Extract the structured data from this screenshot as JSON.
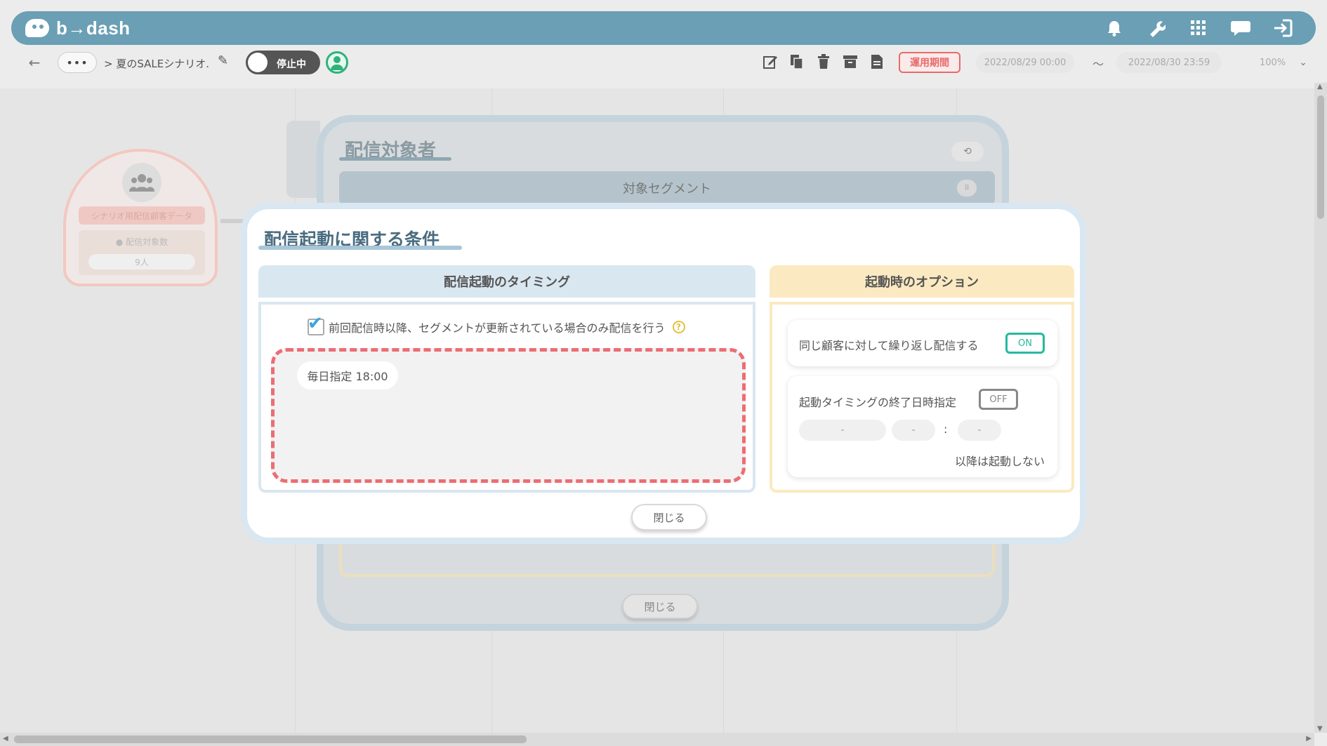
{
  "header": {
    "logo_text": "b→dash",
    "icons": [
      "bell-icon",
      "wrench-icon",
      "apps-grid-icon",
      "chat-icon",
      "logout-icon"
    ]
  },
  "toolbar": {
    "dots_label": "•••",
    "breadcrumb": "> 夏のSALEシナリオ.",
    "status_toggle_label": "停止中",
    "period_label": "運用期間",
    "start_date": "2022/08/29 00:00",
    "tilde": "〜",
    "end_date": "2022/08/30 23:59",
    "zoom": "100%",
    "tool_icons": [
      "edit-icon",
      "copy-icon",
      "trash-icon",
      "archive-icon",
      "document-icon"
    ]
  },
  "canvas_node": {
    "title": "シナリオ用配信顧客データ",
    "sub_label": "配信対象数",
    "value": "9人"
  },
  "background_modal": {
    "title": "配信対象者",
    "section_label": "対象セグメント",
    "close_label": "閉じる"
  },
  "modal": {
    "title": "配信起動に関する条件",
    "timing_header": "配信起動のタイミング",
    "options_header": "起動時のオプション",
    "checkbox_label": "前回配信時以降、セグメントが更新されている場合のみ配信を行う",
    "checkbox_checked": true,
    "help_symbol": "?",
    "timing_entry": "毎日指定 18:00",
    "repeat_label": "同じ顧客に対して繰り返し配信する",
    "repeat_toggle": "ON",
    "end_label": "起動タイミングの終了日時指定",
    "end_toggle": "OFF",
    "end_date_placeholder": "-",
    "end_hour_placeholder": "-",
    "end_minute_placeholder": "-",
    "colon": ":",
    "end_note": "以降は起動しない",
    "close_label": "閉じる"
  },
  "colors": {
    "header_bg": "#6a9fb5",
    "accent_red": "#ec6d73",
    "toggle_on": "#25b9a0",
    "check_blue": "#3aa4e0"
  }
}
